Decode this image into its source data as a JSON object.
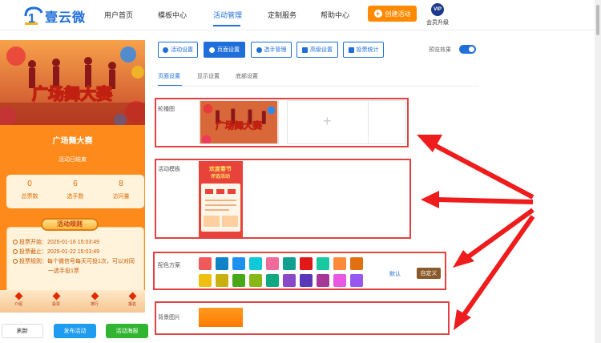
{
  "header": {
    "brand": "壹云微",
    "nav": [
      "用户首页",
      "模板中心",
      "活动管理",
      "定制服务",
      "帮助中心"
    ],
    "active_nav": "活动管理",
    "create_button": "创建活动",
    "vip_badge": "VIP",
    "vip_label": "会员升级"
  },
  "preview": {
    "banner_title": "广场舞大赛",
    "title": "广场舞大赛",
    "status": "活动已结束",
    "stats": [
      {
        "value": "0",
        "label": "总票数"
      },
      {
        "value": "6",
        "label": "选手数"
      },
      {
        "value": "8",
        "label": "访问量"
      }
    ],
    "rules_title": "活动规则",
    "rules": [
      "投票开始：2025-01-16 15:03:49",
      "投票截止：2025-01-22 15:03:49",
      "投票规则：每个微信号每天可投1次，可以对同",
      "一选手投1票"
    ],
    "tabs": [
      "介绍",
      "投票",
      "排行",
      "报名"
    ]
  },
  "bottom_buttons": {
    "refresh": "刷新",
    "publish": "发布活动",
    "poster": "活动海报"
  },
  "toolbar": {
    "buttons": [
      "活动设置",
      "页面设置",
      "选手管理",
      "高级设置",
      "投票统计"
    ],
    "active": "页面设置",
    "preview_label": "预览效果",
    "preview_enabled": true
  },
  "subtabs": {
    "items": [
      "页面设置",
      "显示设置",
      "底部设置"
    ],
    "active": "页面设置"
  },
  "sections": {
    "carousel_label": "轮播图",
    "template_label": "活动模板",
    "template_thumb_title": "欢度春节",
    "template_thumb_sub": "评选活动",
    "color_label": "配色方案",
    "default_link": "默认",
    "custom_button": "自定义",
    "bg_label": "背景图片"
  },
  "colors": {
    "palette_row1": [
      "#f05a5a",
      "#0f82c8",
      "#1e90f0",
      "#10c8d8",
      "#f06a9a",
      "#0fa090",
      "#e01818",
      "#18c8a0",
      "#ff8a3a",
      "#e07010"
    ],
    "palette_row2": [
      "#f0c010",
      "#c8b010",
      "#48a818",
      "#88b818",
      "#10a880",
      "#8848c8",
      "#5838b8",
      "#a83898",
      "#e858e0",
      "#9858f0"
    ],
    "accent": "#1e6fd9",
    "highlight": "#e34040",
    "background_color": "#ff8a00"
  }
}
